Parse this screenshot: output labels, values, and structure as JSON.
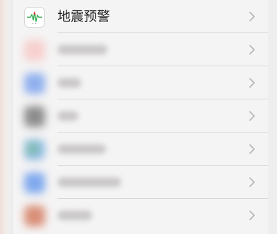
{
  "settings_list": {
    "items": [
      {
        "label": "地震预警",
        "icon": "earthquake-alert-icon",
        "blurred": false,
        "icon_color": "#ffffff"
      },
      {
        "label": "",
        "icon": "blurred-app-icon",
        "blurred": true,
        "icon_color": "#f6cfcd"
      },
      {
        "label": "",
        "icon": "blurred-app-icon",
        "blurred": true,
        "icon_color": "#8fb0ee"
      },
      {
        "label": "",
        "icon": "blurred-app-icon",
        "blurred": true,
        "icon_color": "#8c8c8c"
      },
      {
        "label": "",
        "icon": "blurred-app-icon",
        "blurred": true,
        "icon_color": "#9ac7d8"
      },
      {
        "label": "",
        "icon": "blurred-app-icon",
        "blurred": true,
        "icon_color": "#7fa9ee"
      },
      {
        "label": "",
        "icon": "blurred-app-icon",
        "blurred": true,
        "icon_color": "#d98f78"
      }
    ]
  },
  "colors": {
    "background": "#efeeee",
    "panel": "#f5f4f4",
    "chevron": "#b8b6b6",
    "divider": "#d9d7d7"
  }
}
